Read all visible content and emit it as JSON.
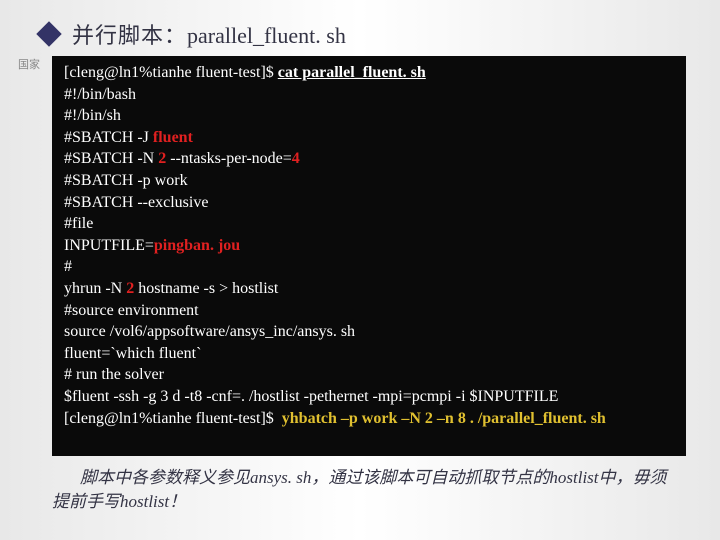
{
  "title": {
    "cn": "并行脚本：",
    "filename": "parallel_fluent. sh"
  },
  "watermark": "国家",
  "terminal": {
    "prompt1_prefix": "[cleng@ln1%tianhe fluent-test]$ ",
    "cmd1": "cat parallel_fluent. sh",
    "l1": "#!/bin/bash",
    "l2": "#!/bin/sh",
    "l3a": "#SBATCH -J ",
    "l3b": "fluent",
    "l4a": "#SBATCH -N ",
    "l4b": "2",
    "l4c": " --ntasks-per-node=",
    "l4d": "4",
    "l5": "#SBATCH -p work",
    "l6": "#SBATCH --exclusive",
    "l7": "#file",
    "l8a": "INPUTFILE=",
    "l8b": "pingban. jou",
    "l9": "#",
    "l10a": "yhrun -N ",
    "l10b": "2",
    "l10c": " hostname -s > hostlist",
    "l11": "#source environment",
    "l12": "source /vol6/appsoftware/ansys_inc/ansys. sh",
    "l13": "fluent=`which fluent`",
    "l14": "# run the solver",
    "l15": "$fluent -ssh -g 3 d -t8 -cnf=. /hostlist -pethernet -mpi=pcmpi -i $INPUTFILE",
    "prompt2_prefix": "[cleng@ln1%tianhe fluent-test]$  ",
    "cmd2": "yhbatch –p work –N 2 –n 8 . /parallel_fluent. sh"
  },
  "footnote": "脚本中各参数释义参见ansys. sh，通过该脚本可自动抓取节点的hostlist中，毋须提前手写hostlist！"
}
